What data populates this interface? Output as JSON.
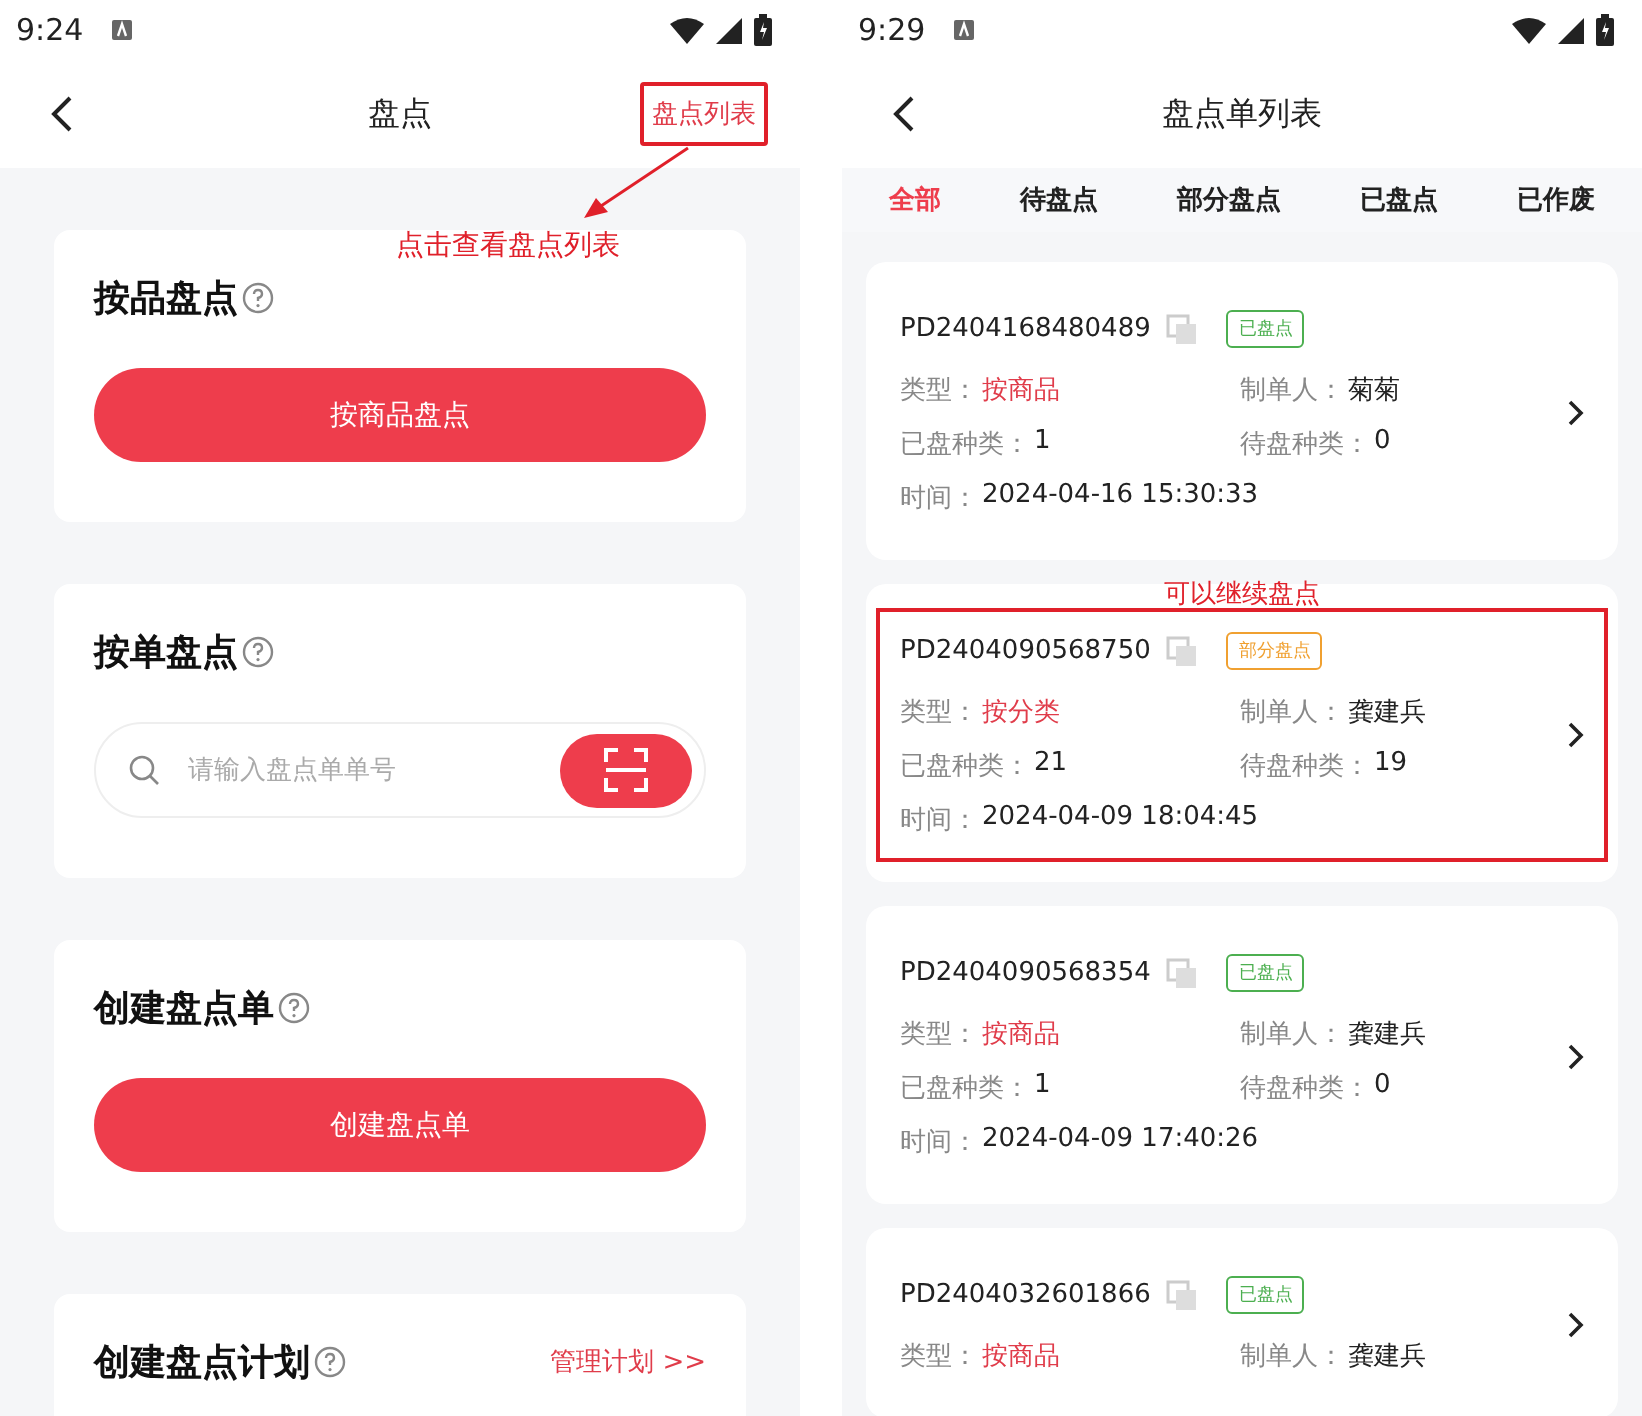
{
  "left_screen": {
    "status_bar": {
      "time": "9:24"
    },
    "header": {
      "title": "盘点",
      "action": "盘点列表",
      "action_marked": true
    },
    "annotation": "点击查看盘点列表",
    "sections": [
      {
        "kind": "button",
        "title": "按品盘点",
        "button": "按商品盘点"
      },
      {
        "kind": "search",
        "title": "按单盘点",
        "placeholder": "请输入盘点单单号"
      },
      {
        "kind": "button",
        "title": "创建盘点单",
        "button": "创建盘点单"
      },
      {
        "kind": "link",
        "title": "创建盘点计划",
        "link": "管理计划 >>"
      }
    ]
  },
  "right_screen": {
    "status_bar": {
      "time": "9:29"
    },
    "header": {
      "title": "盘点单列表"
    },
    "tabs": [
      {
        "label": "全部",
        "selected": true
      },
      {
        "label": "待盘点",
        "selected": false
      },
      {
        "label": "部分盘点",
        "selected": false
      },
      {
        "label": "已盘点",
        "selected": false
      },
      {
        "label": "已作废",
        "selected": false
      }
    ],
    "orders": [
      {
        "id": "PD2404168480489",
        "status": "已盘点",
        "color": "#4caf50",
        "marked": false,
        "rows": [
          [
            {
              "label": "类型：",
              "value": "按商品",
              "accent": true
            },
            {
              "label": "制单人：",
              "value": "菊菊",
              "accent": false
            }
          ],
          [
            {
              "label": "已盘种类：",
              "value": "1",
              "accent": false
            },
            {
              "label": "待盘种类：",
              "value": "0",
              "accent": false
            }
          ],
          [
            {
              "label": "时间：",
              "value": "2024-04-16 15:30:33",
              "accent": false
            }
          ]
        ]
      },
      {
        "id": "PD2404090568750",
        "status": "部分盘点",
        "color": "#f0a030",
        "marked": true,
        "annotation": "可以继续盘点",
        "rows": [
          [
            {
              "label": "类型：",
              "value": "按分类",
              "accent": true
            },
            {
              "label": "制单人：",
              "value": "龚建兵",
              "accent": false
            }
          ],
          [
            {
              "label": "已盘种类：",
              "value": "21",
              "accent": false
            },
            {
              "label": "待盘种类：",
              "value": "19",
              "accent": false
            }
          ],
          [
            {
              "label": "时间：",
              "value": "2024-04-09 18:04:45",
              "accent": false
            }
          ]
        ]
      },
      {
        "id": "PD2404090568354",
        "status": "已盘点",
        "color": "#4caf50",
        "marked": false,
        "rows": [
          [
            {
              "label": "类型：",
              "value": "按商品",
              "accent": true
            },
            {
              "label": "制单人：",
              "value": "龚建兵",
              "accent": false
            }
          ],
          [
            {
              "label": "已盘种类：",
              "value": "1",
              "accent": false
            },
            {
              "label": "待盘种类：",
              "value": "0",
              "accent": false
            }
          ],
          [
            {
              "label": "时间：",
              "value": "2024-04-09 17:40:26",
              "accent": false
            }
          ]
        ]
      },
      {
        "id": "PD2404032601866",
        "status": "已盘点",
        "color": "#4caf50",
        "marked": false,
        "rows": [
          [
            {
              "label": "类型：",
              "value": "按商品",
              "accent": true
            },
            {
              "label": "制单人：",
              "value": "龚建兵",
              "accent": false
            }
          ]
        ]
      }
    ]
  }
}
